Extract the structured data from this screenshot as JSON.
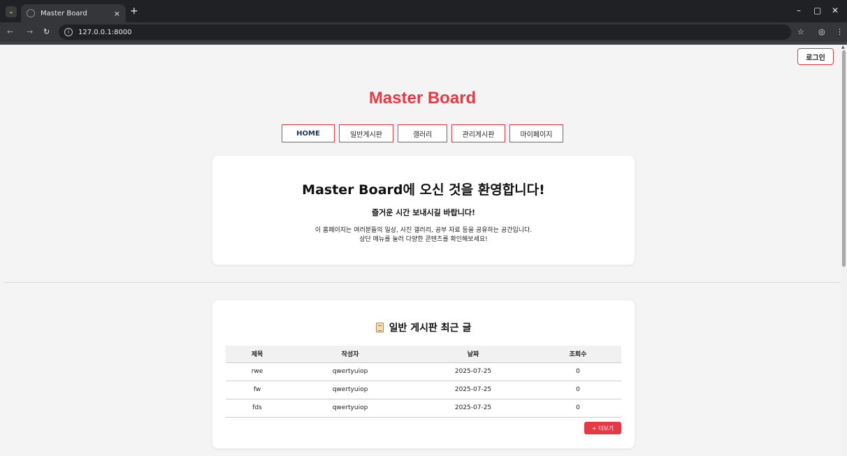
{
  "browser": {
    "tab_title": "Master Board",
    "tab_close": "×",
    "new_tab": "+",
    "url": "127.0.0.1:8000",
    "window_controls": [
      "–",
      "▢",
      "✕"
    ]
  },
  "header": {
    "login_label": "로그인",
    "site_title": "Master Board"
  },
  "menu": {
    "home": "HOME",
    "general_board": "일반게시판",
    "gallery": "갤러리",
    "admin_board": "관리게시판",
    "mypage": "마이페이지"
  },
  "welcome": {
    "title": "Master Board에 오신 것을 환영합니다!",
    "subtitle": "즐거운 시간 보내시길 바랍니다!",
    "line1": "이 홈페이지는 여러분들의 일상, 사진 갤러리, 공부 자료 등을 공유하는 공간입니다.",
    "line2": "상단 메뉴를 눌러 다양한 콘텐츠를 확인해보세요!"
  },
  "recent": {
    "title": "일반 게시판 최근 글",
    "icon": "memo-icon",
    "headers": {
      "title": "제목",
      "author": "작성자",
      "date": "날짜",
      "views": "조회수"
    },
    "rows": [
      {
        "title": "rwe",
        "author": "qwertyuiop",
        "date": "2025-07-25",
        "views": "0"
      },
      {
        "title": "fw",
        "author": "qwertyuiop",
        "date": "2025-07-25",
        "views": "0"
      },
      {
        "title": "fds",
        "author": "qwertyuiop",
        "date": "2025-07-25",
        "views": "0"
      }
    ],
    "more_label": "+ 더보기"
  },
  "colors": {
    "accent": "#e63946",
    "home_text": "#1d3557"
  }
}
